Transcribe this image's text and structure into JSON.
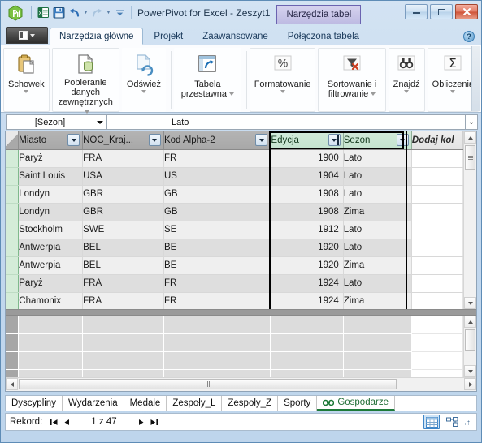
{
  "window": {
    "title": "PowerPivot for Excel - Zeszyt1",
    "contextual_tab": "Narzędzia tabel",
    "app_icon": "powerpivot-icon",
    "quick_access": [
      {
        "name": "excel-icon",
        "label": "Excel"
      },
      {
        "name": "save-icon",
        "label": "Zapisz"
      },
      {
        "name": "undo-icon",
        "label": "Cofnij"
      },
      {
        "name": "redo-icon",
        "label": "Ponów"
      },
      {
        "name": "customize-qat-icon",
        "label": "Dostosuj pasek narzędzi Szybki dostęp"
      }
    ],
    "controls": {
      "minimize": "Minimalizuj",
      "maximize": "Maksymalizuj",
      "close": "Zamknij"
    }
  },
  "ribbon": {
    "file_menu": "Plik",
    "help": "?",
    "tabs": [
      {
        "label": "Narzędzia główne",
        "active": true
      },
      {
        "label": "Projekt",
        "active": false
      },
      {
        "label": "Zaawansowane",
        "active": false
      },
      {
        "label": "Połączona tabela",
        "active": false
      }
    ],
    "groups": [
      {
        "label": "Schowek",
        "icon": "clipboard-icon",
        "dropdown": true
      },
      {
        "label": "Pobieranie danych zewnętrznych",
        "icon": "external-data-icon",
        "dropdown": true
      },
      {
        "label": "Odśwież",
        "icon": "refresh-icon",
        "dropdown": true
      },
      {
        "label": "Tabela przestawna",
        "icon": "pivot-table-icon",
        "dropdown": true
      },
      {
        "label": "Formatowanie",
        "icon": "percent-icon",
        "dropdown": true
      },
      {
        "label": "Sortowanie i filtrowanie",
        "icon": "sort-filter-icon",
        "dropdown": true
      },
      {
        "label": "Znajdź",
        "icon": "binoculars-icon",
        "dropdown": true
      },
      {
        "label": "Obliczenia",
        "icon": "sigma-icon",
        "dropdown": true
      }
    ],
    "overflow_indicator": "▸"
  },
  "formula_bar": {
    "name_box_value": "[Sezon]",
    "formula_value": "Lato",
    "expand_icon": "chevron-double-down-icon"
  },
  "grid": {
    "columns": [
      {
        "key": "miasto",
        "label": "Miasto",
        "filter": true,
        "sorted": false,
        "selected": false,
        "align": "left"
      },
      {
        "key": "noc_kraj",
        "label": "NOC_Kraj...",
        "filter": true,
        "sorted": false,
        "selected": false,
        "align": "left"
      },
      {
        "key": "kod_alpha2",
        "label": "Kod Alpha-2",
        "filter": true,
        "sorted": false,
        "selected": false,
        "align": "left"
      },
      {
        "key": "edycja",
        "label": "Edycja",
        "filter": true,
        "sorted": true,
        "selected": true,
        "align": "right"
      },
      {
        "key": "sezon",
        "label": "Sezon",
        "filter": true,
        "sorted": false,
        "selected": true,
        "align": "left"
      },
      {
        "key": "dodaj",
        "label": "Dodaj kol",
        "filter": false,
        "sorted": false,
        "selected": false,
        "align": "left"
      }
    ],
    "rows": [
      {
        "miasto": "Paryż",
        "noc_kraj": "FRA",
        "kod_alpha2": "FR",
        "edycja": "1900",
        "sezon": "Lato",
        "dodaj": ""
      },
      {
        "miasto": "Saint Louis",
        "noc_kraj": "USA",
        "kod_alpha2": "US",
        "edycja": "1904",
        "sezon": "Lato",
        "dodaj": ""
      },
      {
        "miasto": "Londyn",
        "noc_kraj": "GBR",
        "kod_alpha2": "GB",
        "edycja": "1908",
        "sezon": "Lato",
        "dodaj": ""
      },
      {
        "miasto": "Londyn",
        "noc_kraj": "GBR",
        "kod_alpha2": "GB",
        "edycja": "1908",
        "sezon": "Zima",
        "dodaj": ""
      },
      {
        "miasto": "Stockholm",
        "noc_kraj": "SWE",
        "kod_alpha2": "SE",
        "edycja": "1912",
        "sezon": "Lato",
        "dodaj": ""
      },
      {
        "miasto": "Antwerpia",
        "noc_kraj": "BEL",
        "kod_alpha2": "BE",
        "edycja": "1920",
        "sezon": "Lato",
        "dodaj": ""
      },
      {
        "miasto": "Antwerpia",
        "noc_kraj": "BEL",
        "kod_alpha2": "BE",
        "edycja": "1920",
        "sezon": "Zima",
        "dodaj": ""
      },
      {
        "miasto": "Paryż",
        "noc_kraj": "FRA",
        "kod_alpha2": "FR",
        "edycja": "1924",
        "sezon": "Lato",
        "dodaj": ""
      },
      {
        "miasto": "Chamonix",
        "noc_kraj": "FRA",
        "kod_alpha2": "FR",
        "edycja": "1924",
        "sezon": "Zima",
        "dodaj": ""
      }
    ]
  },
  "sheet_tabs": [
    {
      "label": "Dyscypliny",
      "active": false,
      "linked": false
    },
    {
      "label": "Wydarzenia",
      "active": false,
      "linked": false
    },
    {
      "label": "Medale",
      "active": false,
      "linked": false
    },
    {
      "label": "Zespoły_L",
      "active": false,
      "linked": false
    },
    {
      "label": "Zespoły_Z",
      "active": false,
      "linked": false
    },
    {
      "label": "Sporty",
      "active": false,
      "linked": false
    },
    {
      "label": "Gospodarze",
      "active": true,
      "linked": true
    }
  ],
  "status_bar": {
    "record_label": "Rekord:",
    "position": "1 z 47",
    "first_icon": "first-record-icon",
    "prev_icon": "previous-record-icon",
    "next_icon": "next-record-icon",
    "last_icon": "last-record-icon",
    "view_grid": "data-view-icon",
    "view_diagram": "diagram-view-icon",
    "resize_grip": "resize-grip-icon"
  },
  "colors": {
    "accent_contextual": "#6b63b0",
    "header_gray": "#a8a8a8",
    "header_selected_green": "#c4e4cf",
    "row_select_green": "#d4ecd8",
    "active_tab_green": "#1d7a38",
    "close_red": "#cf5338"
  }
}
